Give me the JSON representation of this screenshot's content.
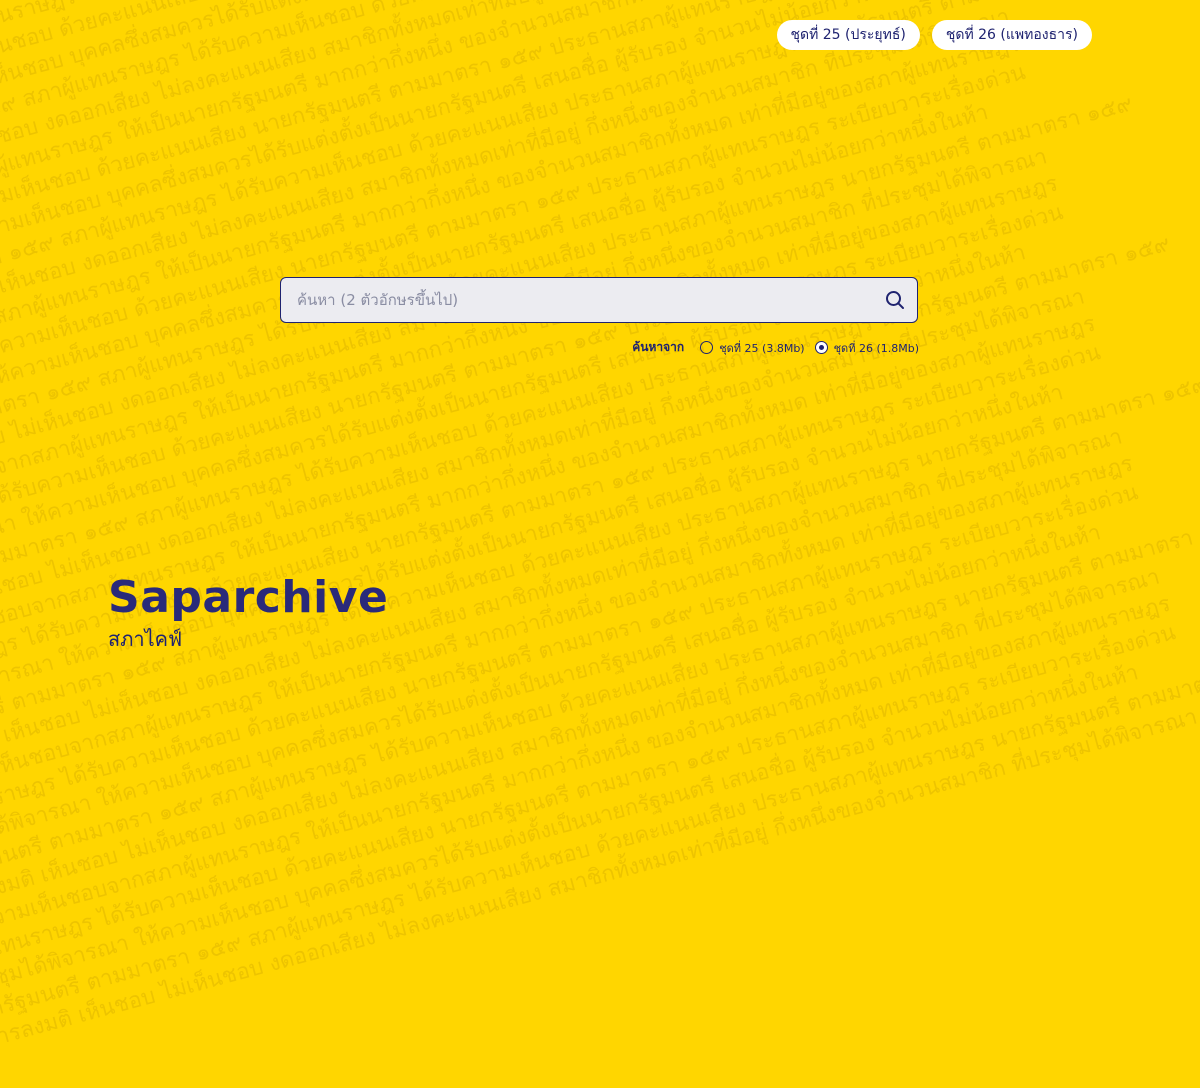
{
  "header": {
    "set25_button": "ชุดที่ 25 (ประยุทธ์)",
    "set26_button": "ชุดที่ 26 (แพทองธาร)"
  },
  "search": {
    "placeholder": "ค้นหา (2 ตัวอักษรขึ้นไป)",
    "value": "",
    "icon": "search-icon",
    "source_label": "ค้นหาจาก",
    "options": [
      {
        "label": "ชุดที่ 25 (3.8Mb)",
        "selected": false
      },
      {
        "label": "ชุดที่ 26 (1.8Mb)",
        "selected": true
      }
    ]
  },
  "brand": {
    "title": "Saparchive",
    "subtitle": "สภาไคฟ์"
  },
  "colors": {
    "background": "#FFD600",
    "accent": "#1f2370",
    "pill_bg": "#ffffff",
    "input_bg": "#ececf1"
  }
}
